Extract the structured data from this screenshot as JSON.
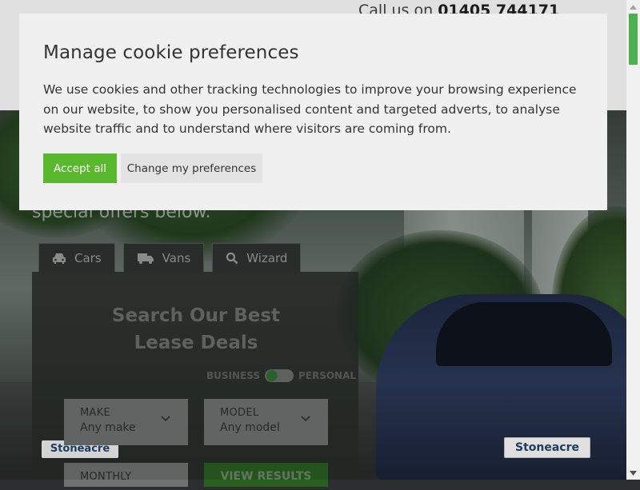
{
  "header": {
    "call_prefix": "Call us on",
    "phone": "01405 744171"
  },
  "hero": {
    "heading_partial": "special offers below.",
    "tabs": [
      {
        "label": "Cars",
        "icon": "car-icon"
      },
      {
        "label": "Vans",
        "icon": "van-icon"
      },
      {
        "label": "Wizard",
        "icon": "search-icon"
      }
    ],
    "panel_title": "Search Our Best Lease Deals",
    "toggle": {
      "left": "BUSINESS",
      "right": "PERSONAL"
    },
    "fields": {
      "make": {
        "label": "MAKE",
        "value": "Any make"
      },
      "model": {
        "label": "MODEL",
        "value": "Any model"
      },
      "monthly": {
        "label": "MONTHLY"
      }
    },
    "results_button": "VIEW RESULTS",
    "plate_text": "Stoneacre"
  },
  "cookie_modal": {
    "title": "Manage cookie preferences",
    "body": "We use cookies and other tracking technologies to improve your browsing experience on our website, to show you personalised content and targeted adverts, to analyse website traffic and to understand where visitors are coming from.",
    "accept_label": "Accept all",
    "preferences_label": "Change my preferences"
  },
  "colors": {
    "accept_green": "#5ab82f",
    "modal_bg": "#f0f0f0",
    "scroll_thumb": "#4caf50"
  }
}
